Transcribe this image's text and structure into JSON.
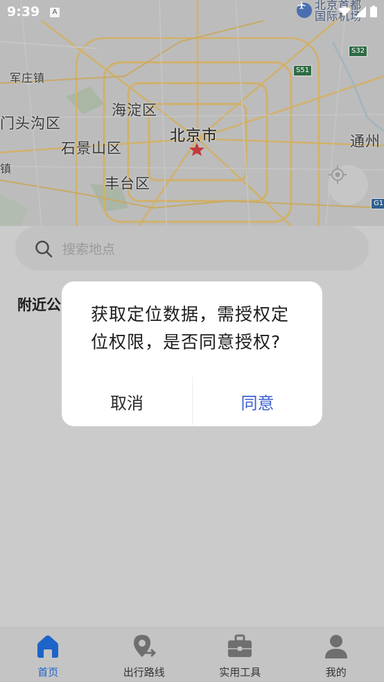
{
  "status_bar": {
    "time": "9:39",
    "notification_letter": "A"
  },
  "map": {
    "labels": {
      "junzhuang": "军庄镇",
      "mentougou": "门头沟区",
      "haidian": "海淀区",
      "beijing": "北京市",
      "shijingshan": "石景山区",
      "fengtai": "丰台区",
      "tongzhou": "通州",
      "zhen": "镇",
      "hu_zhen": "湖镇",
      "airport": "北京首都\n国际机场"
    },
    "road_badges": {
      "s32": "S32",
      "s51": "S51",
      "g1": "G1"
    },
    "locate_button_icon": "crosshair-icon"
  },
  "search": {
    "placeholder": "搜索地点"
  },
  "nearby": {
    "title": "附近公"
  },
  "dialog": {
    "message": "获取定位数据，需授权定位权限，是否同意授权?",
    "cancel_label": "取消",
    "agree_label": "同意"
  },
  "bottom_nav": {
    "items": [
      {
        "label": "首页",
        "icon": "home-icon",
        "active": true
      },
      {
        "label": "出行路线",
        "icon": "route-pin-icon",
        "active": false
      },
      {
        "label": "实用工具",
        "icon": "toolbox-icon",
        "active": false
      },
      {
        "label": "我的",
        "icon": "user-icon",
        "active": false
      }
    ]
  },
  "colors": {
    "accent": "#1e64c8",
    "dialog_agree": "#3d5fd0",
    "overlay_bg": "#cbcbcb"
  }
}
